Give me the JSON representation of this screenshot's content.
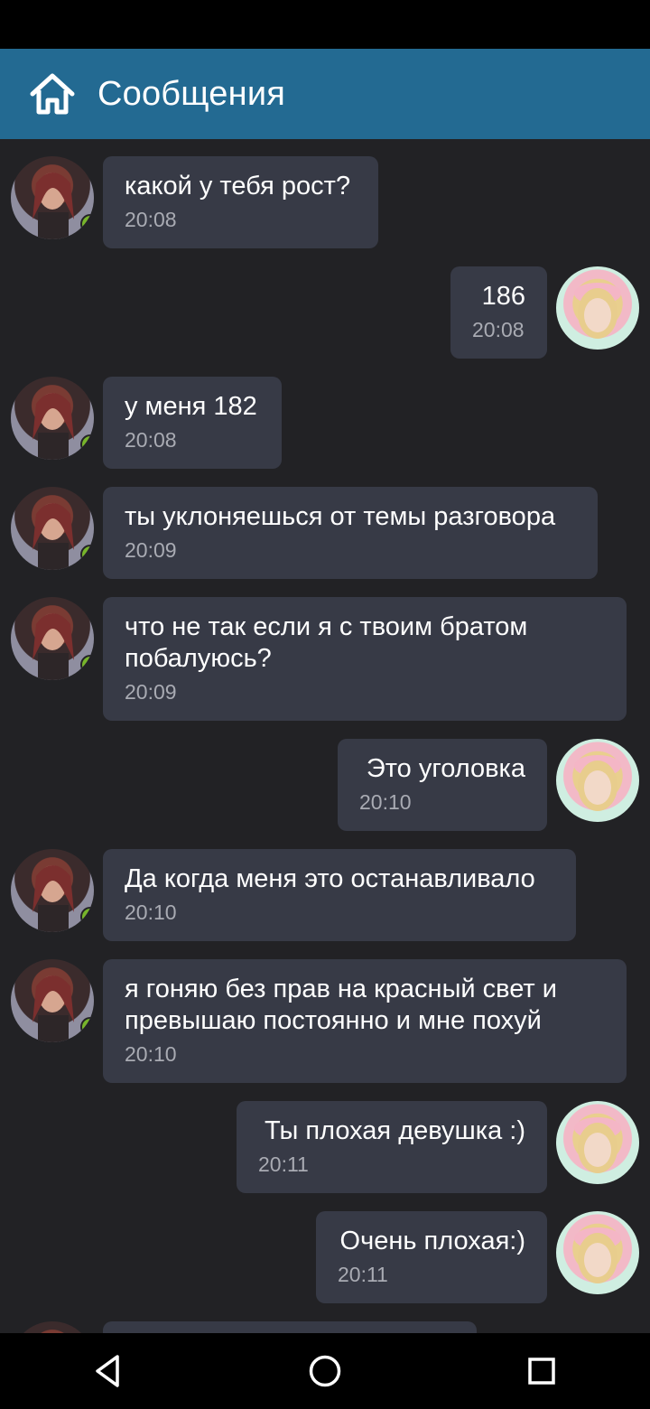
{
  "header": {
    "title": "Сообщения",
    "home_icon": "home-icon"
  },
  "messages": [
    {
      "from": "other",
      "text": "какой у тебя рост?",
      "time": "20:08"
    },
    {
      "from": "me",
      "text": "186",
      "time": "20:08"
    },
    {
      "from": "other",
      "text": "у меня 182",
      "time": "20:08"
    },
    {
      "from": "other",
      "text": "ты уклоняешься от темы разговора",
      "time": "20:09"
    },
    {
      "from": "other",
      "text": "что не так если я с твоим братом\nпобалуюсь?",
      "time": "20:09"
    },
    {
      "from": "me",
      "text": "Это уголовка",
      "time": "20:10"
    },
    {
      "from": "other",
      "text": "Да когда меня это останавливало",
      "time": "20:10"
    },
    {
      "from": "other",
      "text": "я гоняю без прав на красный свет и\nпревышаю постоянно и мне похуй",
      "time": "20:10"
    },
    {
      "from": "me",
      "text": "Ты плохая девушка :)",
      "time": "20:11"
    },
    {
      "from": "me",
      "text": "Очень плохая:)",
      "time": "20:11"
    }
  ],
  "nav": {
    "back": "back-icon",
    "home": "home-circle-icon",
    "recents": "recents-square-icon"
  },
  "colors": {
    "app_bar": "#236a92",
    "background": "#222225",
    "bubble": "#373a46",
    "online": "#77b52a"
  }
}
